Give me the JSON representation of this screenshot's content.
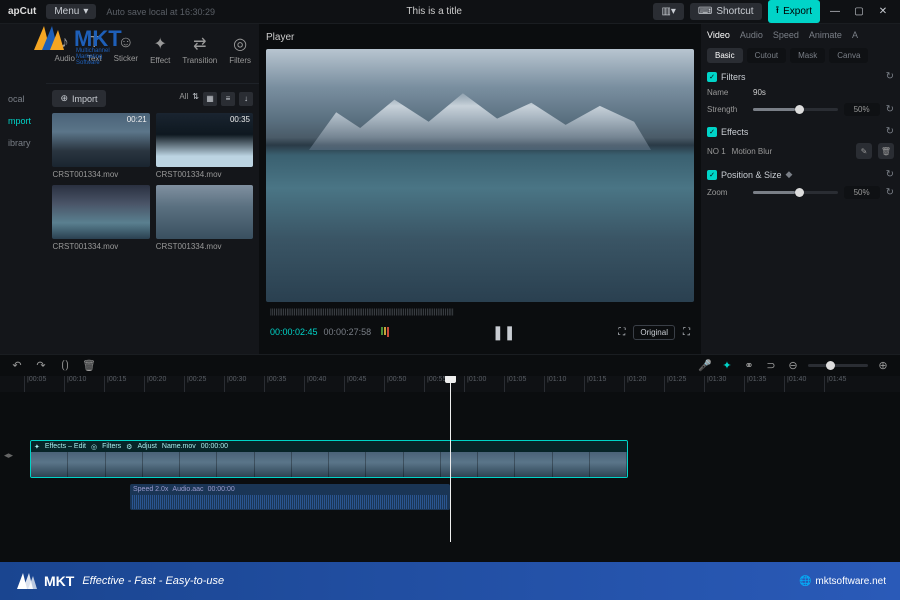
{
  "app": {
    "name": "apCut",
    "menu": "Menu",
    "autosave": "Auto save local at 16:30:29",
    "title": "This is a title"
  },
  "topright": {
    "shortcut": "Shortcut",
    "export": "Export"
  },
  "logo": {
    "text": "MKT",
    "sub": "Multichannel Marketing Software"
  },
  "mediaTabs": [
    "Audio",
    "Text",
    "Sticker",
    "Effect",
    "Transition",
    "Filters"
  ],
  "mediaTabIcons": [
    "♪",
    "T",
    "☺",
    "✦",
    "⇄",
    "◎"
  ],
  "libNav": {
    "local": "ocal",
    "import": "mport",
    "library": "ibrary"
  },
  "import": "Import",
  "viewAll": "All",
  "clips": [
    {
      "dur": "00:21",
      "name": "CRST001334.mov",
      "cls": "mtn"
    },
    {
      "dur": "00:35",
      "name": "CRST001334.mov",
      "cls": "ocean"
    },
    {
      "dur": "",
      "name": "CRST001334.mov",
      "cls": "lake"
    },
    {
      "dur": "",
      "name": "CRST001334.mov",
      "cls": "lake2"
    }
  ],
  "player": {
    "label": "Player",
    "cur": "00:00:02:45",
    "dur": "00:00:27:58",
    "original": "Original"
  },
  "props": {
    "tabs": [
      "Video",
      "Audio",
      "Speed",
      "Animate",
      "A"
    ],
    "subtabs": [
      "Basic",
      "Cutout",
      "Mask",
      "Canva"
    ],
    "filters": {
      "title": "Filters",
      "preset": "90s",
      "strength": "Strength",
      "strength_val": "50%",
      "name_lbl": "Name"
    },
    "effects": {
      "title": "Effects",
      "no": "NO 1",
      "name": "Motion Blur"
    },
    "pos": {
      "title": "Position & Size",
      "zoom": "Zoom",
      "zoom_val": "50%"
    }
  },
  "timeline": {
    "marks": [
      "00:05",
      "00:10",
      "00:15",
      "00:20",
      "00:25",
      "00:30",
      "00:35",
      "00:40",
      "00:45",
      "00:50",
      "00:55",
      "01:00",
      "01:05",
      "01:10",
      "01:15",
      "01:20",
      "01:25",
      "01:30",
      "01:35",
      "01:40",
      "01:45"
    ],
    "videoClip": {
      "fx": "Effects – Edit",
      "fl": "Filters",
      "adj": "Adjust",
      "name": "Name.mov",
      "tc": "00:00:00"
    },
    "audioClip": {
      "speed": "Speed 2.0x",
      "name": "Audio.aac",
      "tc": "00:00:00"
    }
  },
  "footer": {
    "tag": "Effective - Fast - Easy-to-use",
    "url": "mktsoftware.net"
  }
}
